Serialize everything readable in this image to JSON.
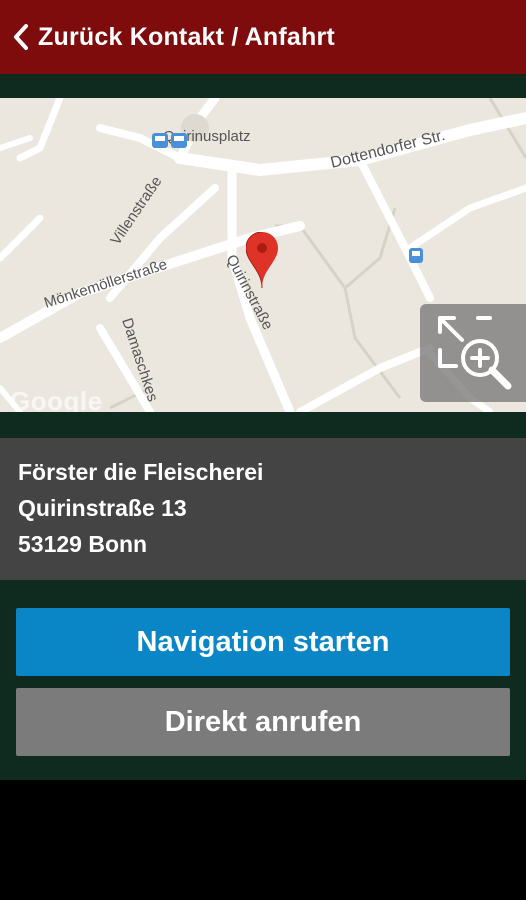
{
  "header": {
    "back_label": "Zurück",
    "title": "Kontakt / Anfahrt",
    "background": "#7f0c0c"
  },
  "map": {
    "labels": {
      "square": "Quirinusplatz",
      "dottendorfer": "Dottendorfer Str.",
      "villen": "Villenstraße",
      "moenkemoeller": "Mönkemöllerstraße",
      "quirin": "Quirinstraße",
      "damaschke": "Damaschkes"
    },
    "provider_logo": "Google",
    "pin_icon": "map-pin-icon",
    "zoom_icon": "expand-zoom-icon"
  },
  "address": {
    "name": "Förster die Fleischerei",
    "street": "Quirinstraße 13",
    "city": "53129 Bonn"
  },
  "buttons": {
    "navigate": "Navigation starten",
    "call": "Direkt anrufen"
  },
  "colors": {
    "content_background": "#0f2a1e",
    "navigate_button": "#0a86c6",
    "call_button": "#7b7b7b",
    "address_background": "#444444"
  }
}
